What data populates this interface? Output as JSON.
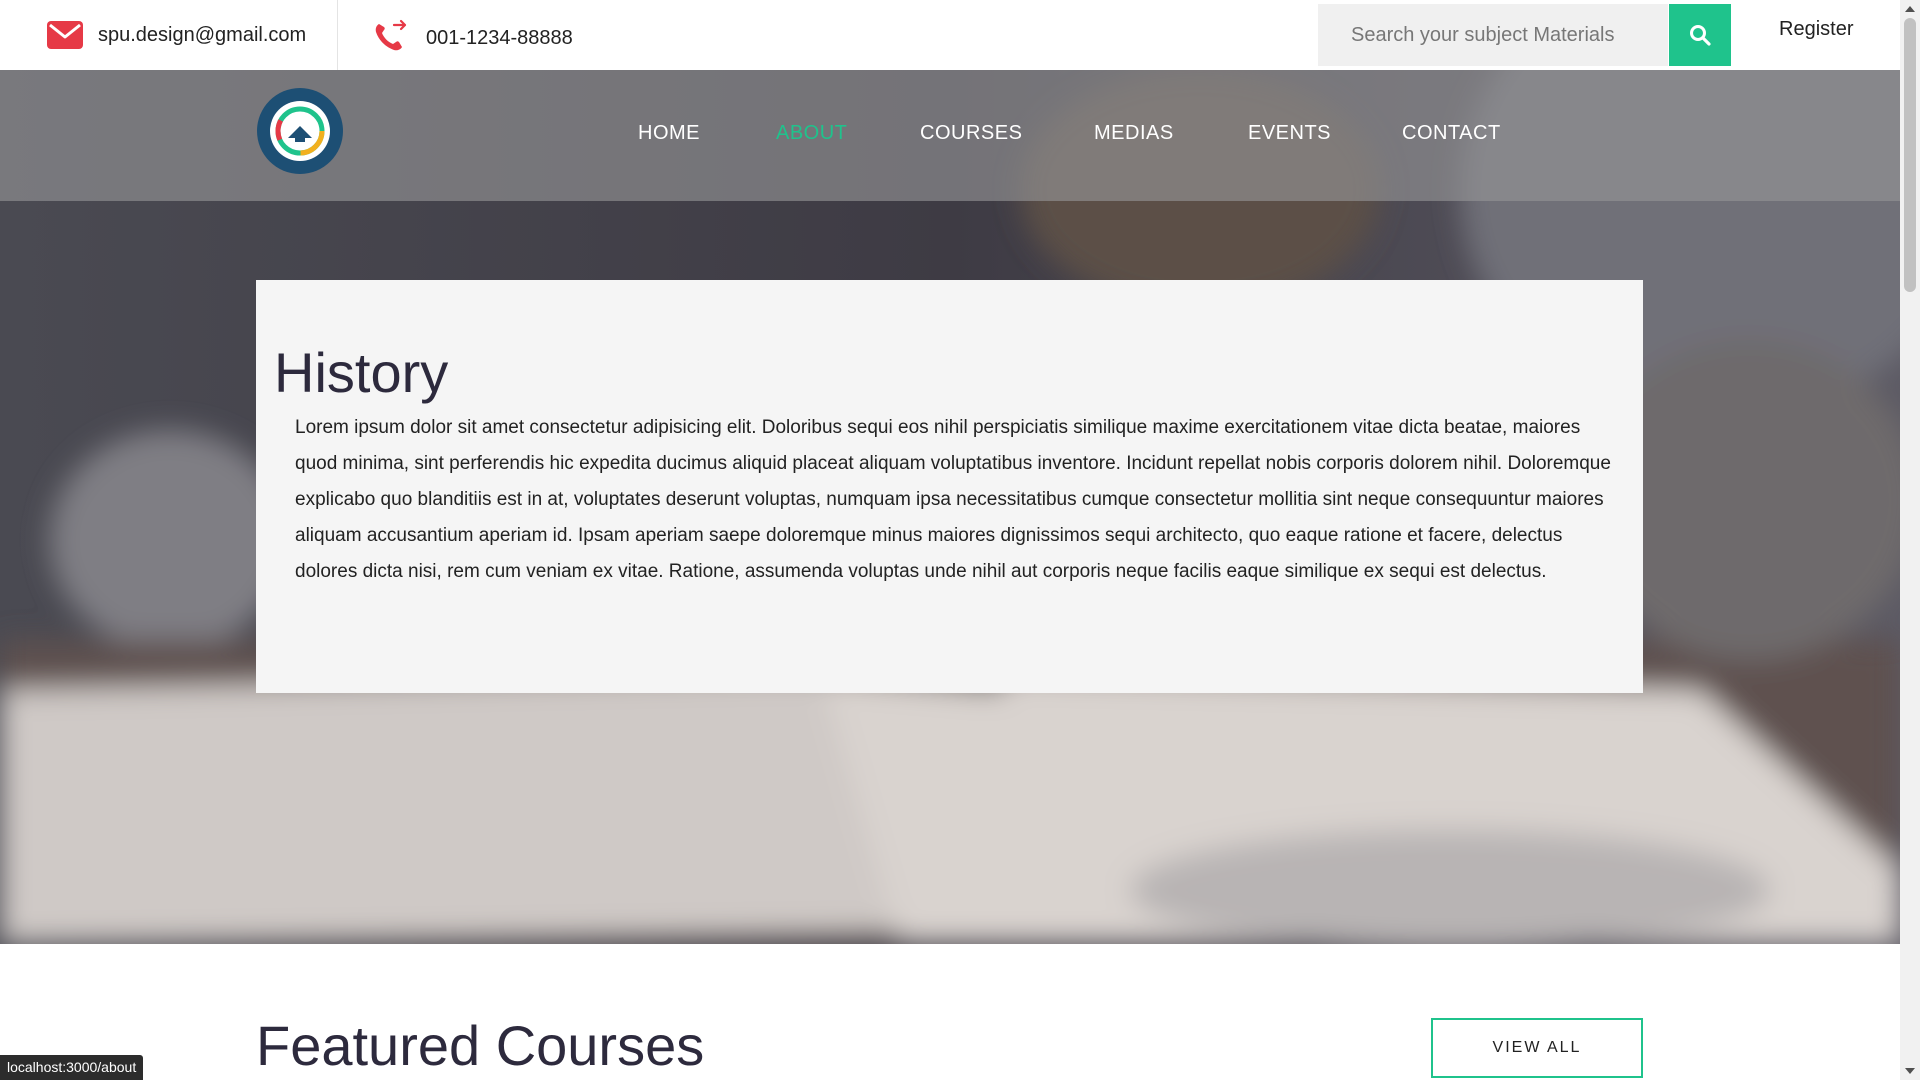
{
  "topbar": {
    "email": "spu.design@gmail.com",
    "phone": "001-1234-88888",
    "search_placeholder": "Search your subject Materials",
    "register_label": "Register",
    "email_icon": "mail-icon",
    "phone_icon": "phone-icon",
    "search_icon": "search-icon"
  },
  "nav": {
    "items": [
      "HOME",
      "ABOUT",
      "COURSES",
      "MEDIAS",
      "EVENTS",
      "CONTACT"
    ],
    "active": "ABOUT"
  },
  "history": {
    "title": "History",
    "body": "Lorem ipsum dolor sit amet consectetur adipisicing elit. Doloribus sequi eos nihil perspiciatis similique maxime exercitationem vitae dicta beatae, maiores quod minima, sint perferendis hic expedita ducimus aliquid placeat aliquam voluptatibus inventore. Incidunt repellat nobis corporis dolorem nihil. Doloremque explicabo quo blanditiis est in at, voluptates deserunt voluptas, numquam ipsa necessitatibus cumque consectetur mollitia sint neque consequuntur maiores aliquam accusantium aperiam id. Ipsam aperiam saepe doloremque minus maiores dignissimos sequi architecto, quo eaque ratione et facere, delectus dolores dicta nisi, rem cum veniam ex vitae. Ratione, assumenda voluptas unde nihil aut corporis neque facilis eaque similique ex sequi est delectus."
  },
  "featured": {
    "title": "Featured Courses",
    "view_all_label": "VIEW ALL"
  },
  "status_bar": {
    "url": "localhost:3000/about"
  },
  "colors": {
    "accent": "#1fc38c",
    "icon_red": "#e63946",
    "heading": "#2d2a3d",
    "card_bg": "#f5f5f5"
  }
}
